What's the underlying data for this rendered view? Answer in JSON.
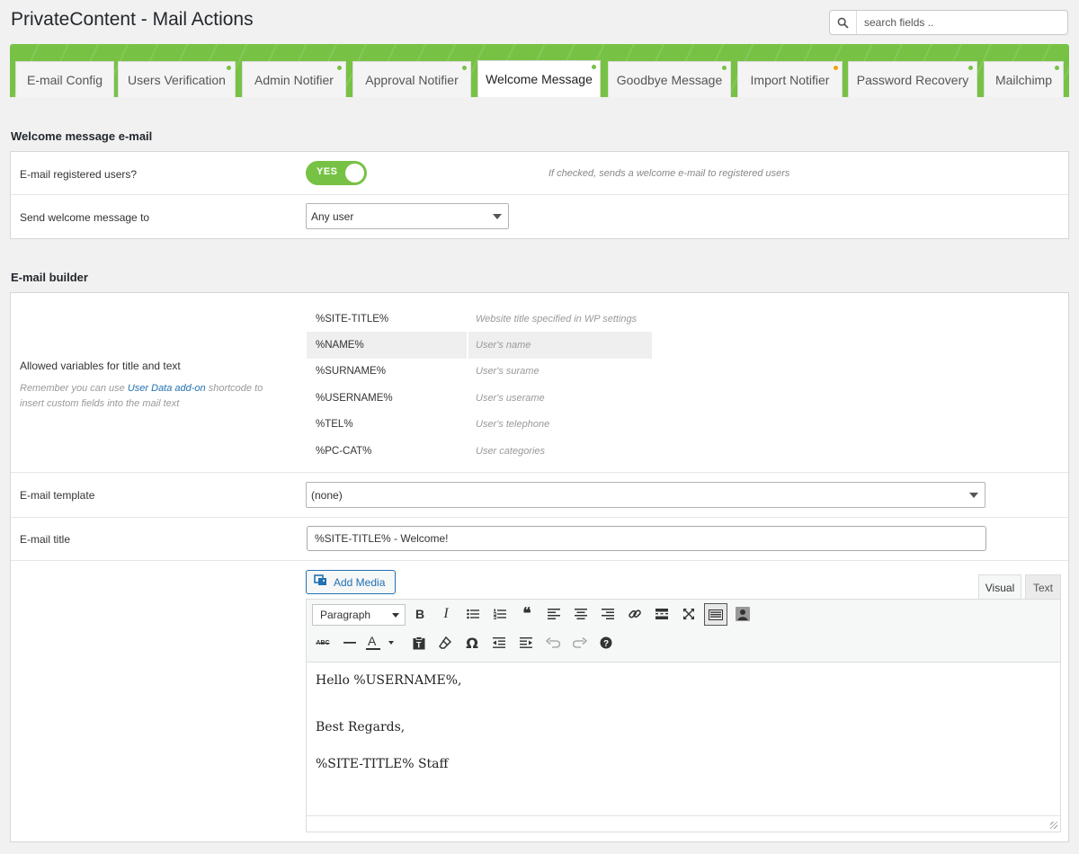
{
  "page": {
    "title": "PrivateContent - Mail Actions"
  },
  "search": {
    "placeholder": "search fields .."
  },
  "colors": {
    "accent": "#77c244",
    "link": "#2271b1",
    "warning_dot": "#f0a30a"
  },
  "tabs": [
    {
      "label": "E-mail Config",
      "dot": "none"
    },
    {
      "label": "Users Verification",
      "dot": "green"
    },
    {
      "label": "Admin Notifier",
      "dot": "green"
    },
    {
      "label": "Approval Notifier",
      "dot": "green"
    },
    {
      "label": "Welcome Message",
      "dot": "green",
      "active": true
    },
    {
      "label": "Goodbye Message",
      "dot": "green"
    },
    {
      "label": "Import Notifier",
      "dot": "orange"
    },
    {
      "label": "Password Recovery",
      "dot": "green"
    },
    {
      "label": "Mailchimp",
      "dot": "green"
    }
  ],
  "welcome": {
    "section_title": "Welcome message e-mail",
    "registered_label": "E-mail registered users?",
    "toggle_text": "YES",
    "registered_hint": "If checked, sends a welcome e-mail to registered users",
    "send_to_label": "Send welcome message to",
    "send_to_value": "Any user"
  },
  "builder": {
    "section_title": "E-mail builder",
    "vars_label": "Allowed variables for title and text",
    "note_prefix": "Remember you can use ",
    "note_link": "User Data add-on",
    "note_suffix": " shortcode to insert custom fields into the mail text",
    "variables": [
      {
        "name": "%SITE-TITLE%",
        "desc": "Website title specified in WP settings"
      },
      {
        "name": "%NAME%",
        "desc": "User's name"
      },
      {
        "name": "%SURNAME%",
        "desc": "User's surame"
      },
      {
        "name": "%USERNAME%",
        "desc": "User's userame"
      },
      {
        "name": "%TEL%",
        "desc": "User's telephone"
      },
      {
        "name": "%PC-CAT%",
        "desc": "User categories"
      }
    ],
    "template_label": "E-mail template",
    "template_value": "(none)",
    "title_label": "E-mail title",
    "title_value": "%SITE-TITLE% - Welcome!"
  },
  "editor": {
    "add_media": "Add Media",
    "tab_visual": "Visual",
    "tab_text": "Text",
    "format_select": "Paragraph",
    "content": [
      "Hello %USERNAME%,",
      "Best Regards,",
      "%SITE-TITLE% Staff"
    ]
  }
}
